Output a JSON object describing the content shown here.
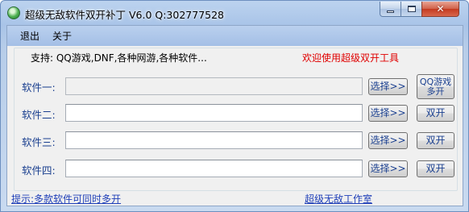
{
  "window": {
    "title": "超级无敌软件双开补丁 V6.0  Q:302777528",
    "min_glyph": "",
    "max_glyph": "",
    "close_glyph": "✕"
  },
  "menu": {
    "items": [
      "退出",
      "关于"
    ]
  },
  "info": {
    "support": "支持: QQ游戏,DNF,各种网游,各种软件...",
    "welcome": "欢迎使用超级双开工具"
  },
  "rows": [
    {
      "label": "软件一:",
      "value": "",
      "select_label": "选择>>",
      "action_label": "QQ游戏 多开",
      "action_line1": "QQ游戏",
      "action_line2": "多开",
      "disabled": true
    },
    {
      "label": "软件二:",
      "value": "",
      "select_label": "选择>>",
      "action_label": "双开"
    },
    {
      "label": "软件三:",
      "value": "",
      "select_label": "选择>>",
      "action_label": "双开"
    },
    {
      "label": "软件四:",
      "value": "",
      "select_label": "选择>>",
      "action_label": "双开"
    }
  ],
  "status": {
    "hint": "提示:多款软件可同时多开",
    "studio": "超级无敌工作室"
  },
  "colors": {
    "label_blue": "#1a3f8f",
    "welcome_red": "#e00000",
    "link_blue": "#1f3fb8",
    "close_red": "#c43a20"
  },
  "icons": {
    "app": "green-orb-icon",
    "minimize": "minimize-icon",
    "maximize": "maximize-icon",
    "close": "close-icon"
  }
}
